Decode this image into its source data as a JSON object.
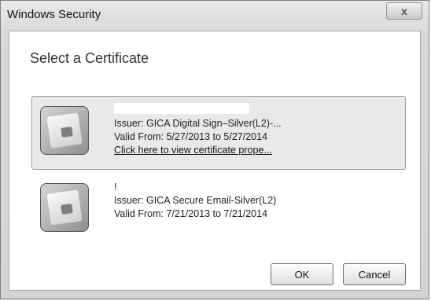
{
  "window": {
    "title": "Windows Security",
    "close_label": "x"
  },
  "dialog": {
    "heading": "Select a Certificate"
  },
  "certificates": [
    {
      "name": "",
      "issuer": "Issuer: GICA Digital Sign–Silver(L2)-...",
      "valid": "Valid From: 5/27/2013 to 5/27/2014",
      "link": "Click here to view certificate prope...",
      "selected": true
    },
    {
      "name": "!",
      "issuer": "Issuer: GICA Secure Email-Silver(L2)",
      "valid": "Valid From: 7/21/2013 to 7/21/2014",
      "selected": false
    }
  ],
  "buttons": {
    "ok": "OK",
    "cancel": "Cancel"
  }
}
